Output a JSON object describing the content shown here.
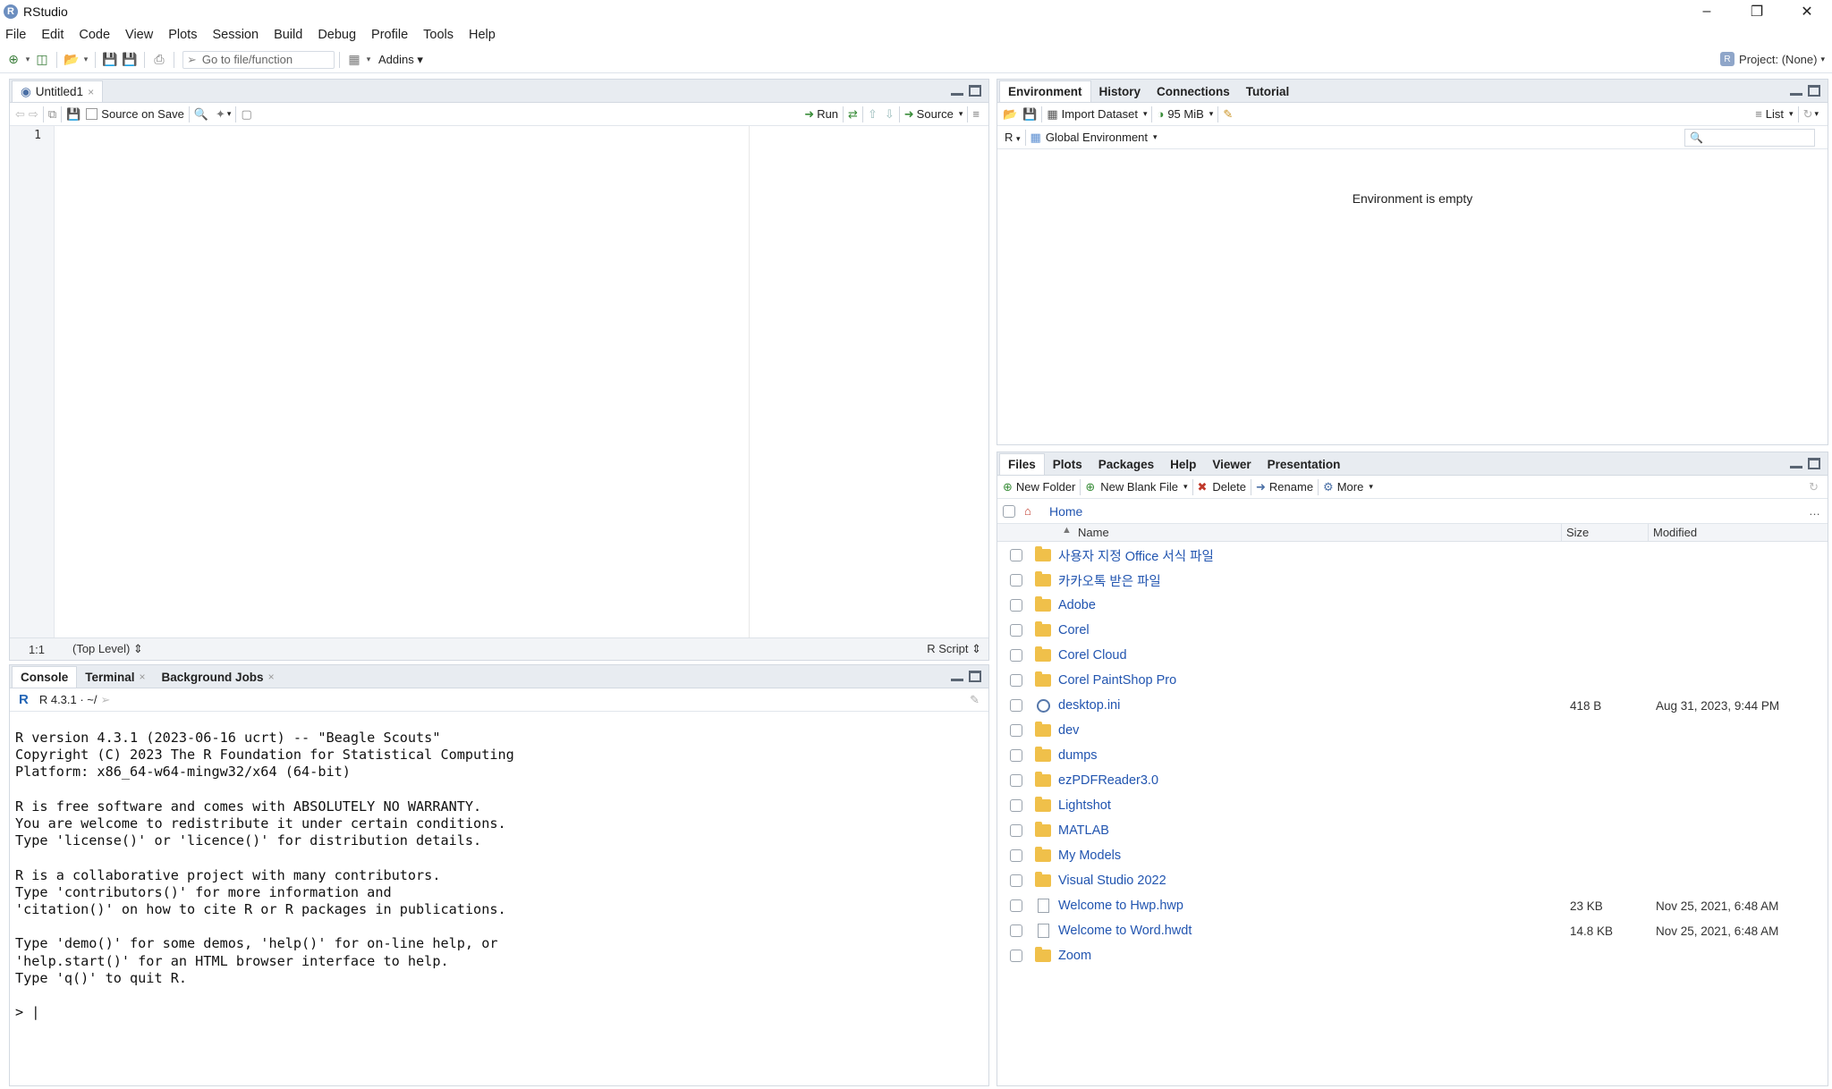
{
  "window": {
    "title": "RStudio",
    "app_icon": "R"
  },
  "menu": [
    "File",
    "Edit",
    "Code",
    "View",
    "Plots",
    "Session",
    "Build",
    "Debug",
    "Profile",
    "Tools",
    "Help"
  ],
  "toolbar": {
    "goto_placeholder": "Go to file/function",
    "addins": "Addins",
    "project": "Project: (None)"
  },
  "source": {
    "tab": "Untitled1",
    "source_on_save": "Source on Save",
    "run": "Run",
    "source_btn": "Source",
    "line_number": "1",
    "status_pos": "1:1",
    "status_scope": "(Top Level)",
    "status_type": "R Script"
  },
  "console": {
    "tabs": [
      "Console",
      "Terminal",
      "Background Jobs"
    ],
    "version": "R 4.3.1 · ~/",
    "text": "R version 4.3.1 (2023-06-16 ucrt) -- \"Beagle Scouts\"\nCopyright (C) 2023 The R Foundation for Statistical Computing\nPlatform: x86_64-w64-mingw32/x64 (64-bit)\n\nR is free software and comes with ABSOLUTELY NO WARRANTY.\nYou are welcome to redistribute it under certain conditions.\nType 'license()' or 'licence()' for distribution details.\n\nR is a collaborative project with many contributors.\nType 'contributors()' for more information and\n'citation()' on how to cite R or R packages in publications.\n\nType 'demo()' for some demos, 'help()' for on-line help, or\n'help.start()' for an HTML browser interface to help.\nType 'q()' to quit R.\n\n> |"
  },
  "environment": {
    "tabs": [
      "Environment",
      "History",
      "Connections",
      "Tutorial"
    ],
    "import_dataset": "Import Dataset",
    "memory": "95 MiB",
    "view_mode": "List",
    "language": "R",
    "scope": "Global Environment",
    "empty_message": "Environment is empty"
  },
  "files": {
    "tabs": [
      "Files",
      "Plots",
      "Packages",
      "Help",
      "Viewer",
      "Presentation"
    ],
    "new_folder": "New Folder",
    "new_blank_file": "New Blank File",
    "delete": "Delete",
    "rename": "Rename",
    "more": "More",
    "breadcrumb": "Home",
    "columns": {
      "name": "Name",
      "size": "Size",
      "modified": "Modified"
    },
    "rows": [
      {
        "name": "사용자 지정 Office 서식 파일",
        "type": "folder",
        "size": "",
        "modified": ""
      },
      {
        "name": "카카오톡 받은 파일",
        "type": "folder",
        "size": "",
        "modified": ""
      },
      {
        "name": "Adobe",
        "type": "folder",
        "size": "",
        "modified": ""
      },
      {
        "name": "Corel",
        "type": "folder",
        "size": "",
        "modified": ""
      },
      {
        "name": "Corel Cloud",
        "type": "folder",
        "size": "",
        "modified": ""
      },
      {
        "name": "Corel PaintShop Pro",
        "type": "folder",
        "size": "",
        "modified": ""
      },
      {
        "name": "desktop.ini",
        "type": "config",
        "size": "418 B",
        "modified": "Aug 31, 2023, 9:44 PM"
      },
      {
        "name": "dev",
        "type": "folder",
        "size": "",
        "modified": ""
      },
      {
        "name": "dumps",
        "type": "folder",
        "size": "",
        "modified": ""
      },
      {
        "name": "ezPDFReader3.0",
        "type": "folder",
        "size": "",
        "modified": ""
      },
      {
        "name": "Lightshot",
        "type": "folder",
        "size": "",
        "modified": ""
      },
      {
        "name": "MATLAB",
        "type": "folder",
        "size": "",
        "modified": ""
      },
      {
        "name": "My Models",
        "type": "folder",
        "size": "",
        "modified": ""
      },
      {
        "name": "Visual Studio 2022",
        "type": "folder",
        "size": "",
        "modified": ""
      },
      {
        "name": "Welcome to Hwp.hwp",
        "type": "file",
        "size": "23 KB",
        "modified": "Nov 25, 2021, 6:48 AM"
      },
      {
        "name": "Welcome to Word.hwdt",
        "type": "file",
        "size": "14.8 KB",
        "modified": "Nov 25, 2021, 6:48 AM"
      },
      {
        "name": "Zoom",
        "type": "folder",
        "size": "",
        "modified": ""
      }
    ]
  }
}
